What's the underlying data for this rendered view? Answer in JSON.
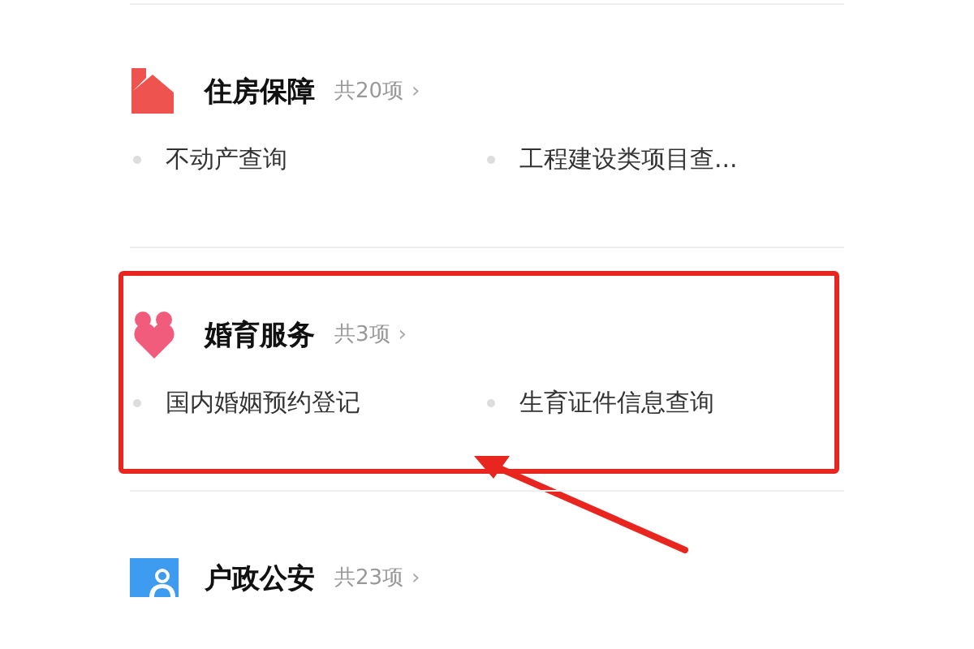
{
  "sections": [
    {
      "kind": "house",
      "title": "住房保障",
      "count": "共20项",
      "chevron": "›",
      "highlighted": false,
      "items": [
        "不动产查询",
        "工程建设类项目查..."
      ]
    },
    {
      "kind": "heart",
      "title": "婚育服务",
      "count": "共3项",
      "chevron": "›",
      "highlighted": true,
      "items": [
        "国内婚姻预约登记",
        "生育证件信息查询"
      ]
    },
    {
      "kind": "person-card",
      "title": "户政公安",
      "count": "共23项",
      "chevron": "›",
      "highlighted": false
    }
  ]
}
